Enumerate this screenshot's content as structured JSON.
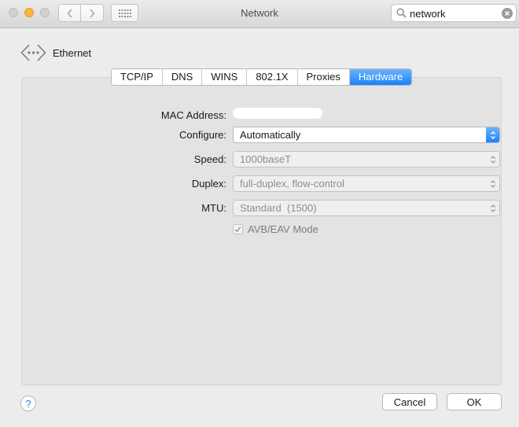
{
  "window": {
    "title": "Network"
  },
  "search": {
    "value": "network"
  },
  "interface": {
    "name": "Ethernet"
  },
  "tabs": [
    {
      "label": "TCP/IP",
      "active": false
    },
    {
      "label": "DNS",
      "active": false
    },
    {
      "label": "WINS",
      "active": false
    },
    {
      "label": "802.1X",
      "active": false
    },
    {
      "label": "Proxies",
      "active": false
    },
    {
      "label": "Hardware",
      "active": true
    }
  ],
  "hardware": {
    "mac_address": {
      "label": "MAC Address:"
    },
    "configure": {
      "label": "Configure:",
      "value": "Automatically"
    },
    "speed": {
      "label": "Speed:",
      "value": "1000baseT"
    },
    "duplex": {
      "label": "Duplex:",
      "value": "full-duplex, flow-control"
    },
    "mtu": {
      "label": "MTU:",
      "value": "Standard  (1500)"
    },
    "avb": {
      "label": "AVB/EAV Mode",
      "checked": true
    }
  },
  "buttons": {
    "help": "?",
    "cancel": "Cancel",
    "ok": "OK"
  },
  "colors": {
    "accent": "#1a82fb",
    "minimize": "#f8b73c"
  }
}
